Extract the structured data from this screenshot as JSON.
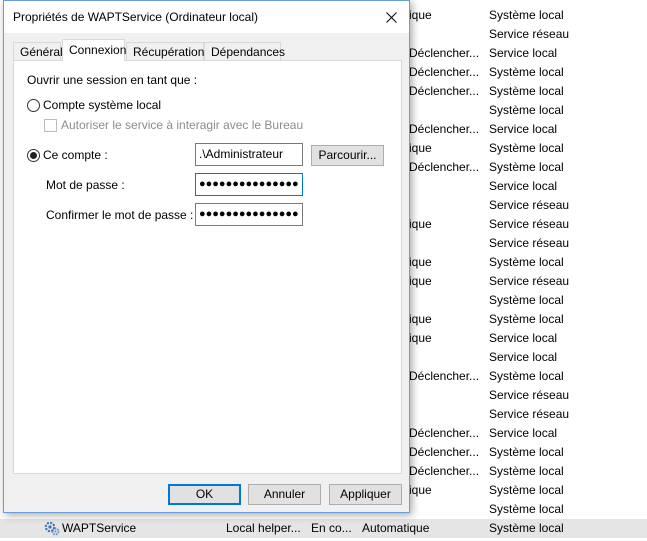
{
  "dialog": {
    "title": "Propriétés de WAPTService (Ordinateur local)",
    "tabs": [
      "Général",
      "Connexion",
      "Récupération",
      "Dépendances"
    ],
    "active_tab": "Connexion",
    "logon_as_label": "Ouvrir une session en tant que :",
    "local_system_label": "Compte système local",
    "interact_desktop_label": "Autoriser le service à interagir avec le Bureau",
    "this_account_label": "Ce compte :",
    "account_value": ".\\Administrateur",
    "browse_button": "Parcourir...",
    "password_label": "Mot de passe :",
    "password_value": "●●●●●●●●●●●●●●●",
    "confirm_password_label": "Confirmer le mot de passe :",
    "confirm_password_value": "●●●●●●●●●●●●●●●",
    "ok_button": "OK",
    "cancel_button": "Annuler",
    "apply_button": "Appliquer"
  },
  "services_list": {
    "rows": [
      {
        "startup": "ique",
        "logon": "Système local"
      },
      {
        "startup": "",
        "logon": "Service réseau"
      },
      {
        "startup": "Déclencher...",
        "logon": "Service local"
      },
      {
        "startup": "Déclencher...",
        "logon": "Système local"
      },
      {
        "startup": "Déclencher...",
        "logon": "Système local"
      },
      {
        "startup": "",
        "logon": "Système local"
      },
      {
        "startup": "Déclencher...",
        "logon": "Service local"
      },
      {
        "startup": "ique",
        "logon": "Système local"
      },
      {
        "startup": "Déclencher...",
        "logon": "Système local"
      },
      {
        "startup": "",
        "logon": "Service local"
      },
      {
        "startup": "",
        "logon": "Service réseau"
      },
      {
        "startup": "ique",
        "logon": "Service réseau"
      },
      {
        "startup": "",
        "logon": "Service réseau"
      },
      {
        "startup": "ique",
        "logon": "Système local"
      },
      {
        "startup": "ique",
        "logon": "Service réseau"
      },
      {
        "startup": "",
        "logon": "Système local"
      },
      {
        "startup": "ique",
        "logon": "Système local"
      },
      {
        "startup": "ique",
        "logon": "Service local"
      },
      {
        "startup": "",
        "logon": "Service local"
      },
      {
        "startup": "Déclencher...",
        "logon": "Système local"
      },
      {
        "startup": "",
        "logon": "Service réseau"
      },
      {
        "startup": "",
        "logon": "Service réseau"
      },
      {
        "startup": "Déclencher...",
        "logon": "Service local"
      },
      {
        "startup": "Déclencher...",
        "logon": "Système local"
      },
      {
        "startup": "Déclencher...",
        "logon": "Système local"
      },
      {
        "startup": "ique",
        "logon": "Système local"
      },
      {
        "startup": "",
        "logon": "Système local"
      }
    ],
    "selected_row": {
      "name": "WAPTService",
      "description": "Local helper...",
      "status": "En co...",
      "startup": "Automatique",
      "logon": "Système local"
    }
  }
}
